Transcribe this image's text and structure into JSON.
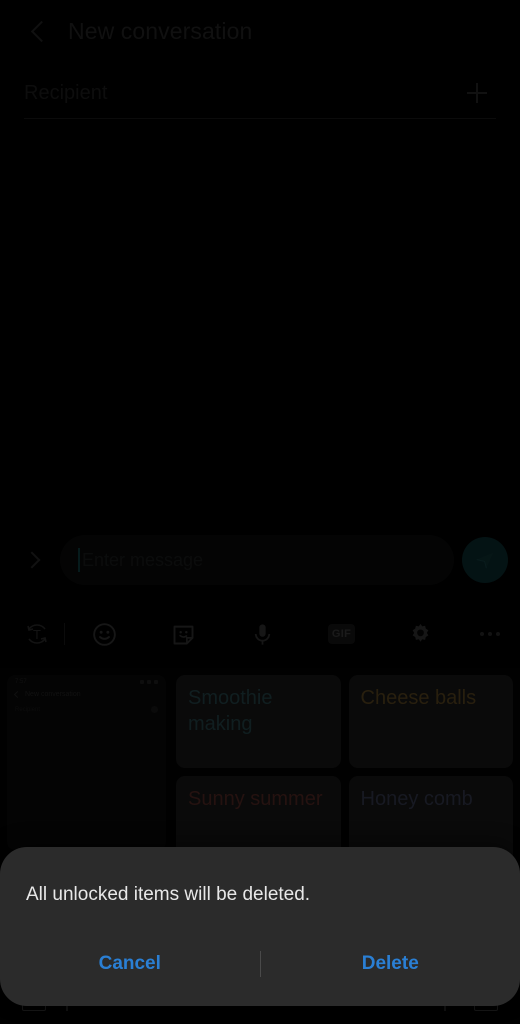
{
  "colors": {
    "accent_blue": "#2a7fd4",
    "send_button_teal": "#0c3235",
    "dialog_bg": "#2b2b2b",
    "screen_bg": "#000000",
    "card_bg": "#1b1b1b"
  },
  "header": {
    "back_icon": "chevron-left-icon",
    "title": "New conversation"
  },
  "recipient": {
    "placeholder": "Recipient",
    "value": "",
    "add_icon": "plus-icon"
  },
  "compose": {
    "expand_icon": "chevron-right-icon",
    "placeholder": "Enter message",
    "value": "",
    "send_icon": "send-paper-plane-icon"
  },
  "toolbar": {
    "items": [
      {
        "name": "text-mode-toggle",
        "icon": "t-in-circular-arrow-icon",
        "label": "T"
      },
      {
        "name": "divider",
        "icon": "divider",
        "label": ""
      },
      {
        "name": "emoji-button",
        "icon": "smiley-face-icon",
        "label": ""
      },
      {
        "name": "sticker-button",
        "icon": "sticker-icon",
        "label": ""
      },
      {
        "name": "voice-button",
        "icon": "microphone-icon",
        "label": ""
      },
      {
        "name": "gif-button",
        "icon": "gif-icon",
        "label": "GIF"
      },
      {
        "name": "settings-button",
        "icon": "gear-icon",
        "label": ""
      },
      {
        "name": "more-button",
        "icon": "overflow-dots-icon",
        "label": ""
      }
    ]
  },
  "preview_panel": {
    "status_time": "7:57",
    "title": "New conversation",
    "recipient_label": "Recipient"
  },
  "cards": [
    {
      "text": "Smoothie making",
      "color": "#2c5055"
    },
    {
      "text": "Cheese balls",
      "color": "#6b5326"
    },
    {
      "text": "Sunny summer",
      "color": "#63302b"
    },
    {
      "text": "Honey comb",
      "color": "#3d4359"
    }
  ],
  "dialog": {
    "message": "All unlocked items will be deleted.",
    "cancel_label": "Cancel",
    "delete_label": "Delete"
  }
}
